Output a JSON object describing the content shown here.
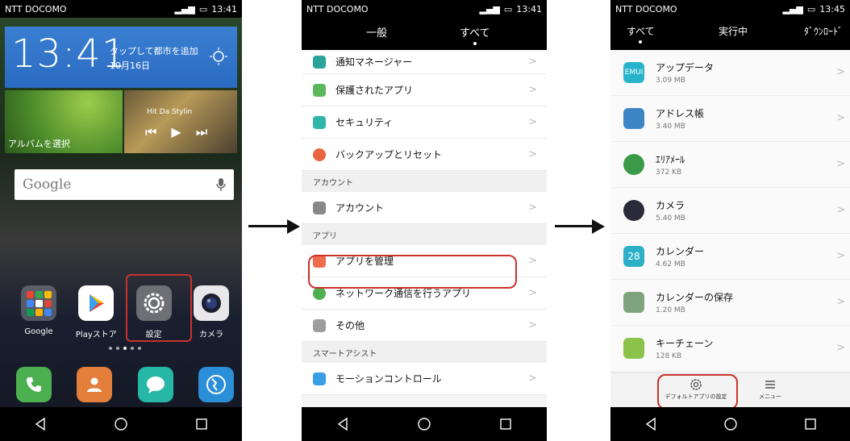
{
  "phone1": {
    "status": {
      "carrier": "NTT DOCOMO",
      "time": "13:41"
    },
    "clock": {
      "time": "13:41",
      "cta": "タップして都市を追加",
      "date": "10月16日"
    },
    "album_label": "アルバムを選択",
    "music_title": "Hit Da Stylin",
    "search_placeholder": "Google",
    "apps": [
      {
        "label": "Google",
        "icon": "google-folder-icon"
      },
      {
        "label": "Playストア",
        "icon": "play-store-icon"
      },
      {
        "label": "設定",
        "icon": "settings-gear-icon"
      },
      {
        "label": "カメラ",
        "icon": "camera-icon"
      }
    ],
    "dock": [
      "phone-icon",
      "contacts-icon",
      "messages-icon",
      "browser-icon"
    ]
  },
  "phone2": {
    "status": {
      "carrier": "NTT DOCOMO",
      "time": "13:41"
    },
    "tabs": [
      "一般",
      "すべて"
    ],
    "rows": [
      {
        "label": "通知マネージャー",
        "color": "#2aa39a"
      },
      {
        "label": "保護されたアプリ",
        "color": "#5cb85c"
      },
      {
        "label": "セキュリティ",
        "color": "#2fb6a8"
      },
      {
        "label": "バックアップとリセット",
        "color": "#e9643f"
      }
    ],
    "section_account": "アカウント",
    "account_row": "アカウント",
    "section_apps": "アプリ",
    "apps_rows": [
      "アプリを管理",
      "ネットワーク通信を行うアプリ",
      "その他"
    ],
    "section_smart": "スマートアシスト",
    "smart_row": "モーションコントロール"
  },
  "phone3": {
    "status": {
      "carrier": "NTT DOCOMO",
      "time": "13:45"
    },
    "tabs": [
      "すべて",
      "実行中",
      "ﾀﾞｳﾝﾛｰﾄﾞ"
    ],
    "apps": [
      {
        "name": "アップデータ",
        "size": "3.09 MB",
        "badge": "EMUI",
        "color": "#27b3c9"
      },
      {
        "name": "アドレス帳",
        "size": "3.40 MB",
        "badge": "",
        "color": "#3d86c6"
      },
      {
        "name": "ｴﾘｱﾒｰﾙ",
        "size": "372 KB",
        "badge": "",
        "color": "#3b9a48"
      },
      {
        "name": "カメラ",
        "size": "5.40 MB",
        "badge": "",
        "color": "#2a2a3a"
      },
      {
        "name": "カレンダー",
        "size": "4.62 MB",
        "badge": "28",
        "color": "#2bb0c8"
      },
      {
        "name": "カレンダーの保存",
        "size": "1.20 MB",
        "badge": "",
        "color": "#7fa37a"
      },
      {
        "name": "キーチェーン",
        "size": "128 KB",
        "badge": "",
        "color": "#8bc34a"
      }
    ],
    "bottom": {
      "default_apps": "デフォルトアプリの設定",
      "menu": "メニュー"
    }
  }
}
